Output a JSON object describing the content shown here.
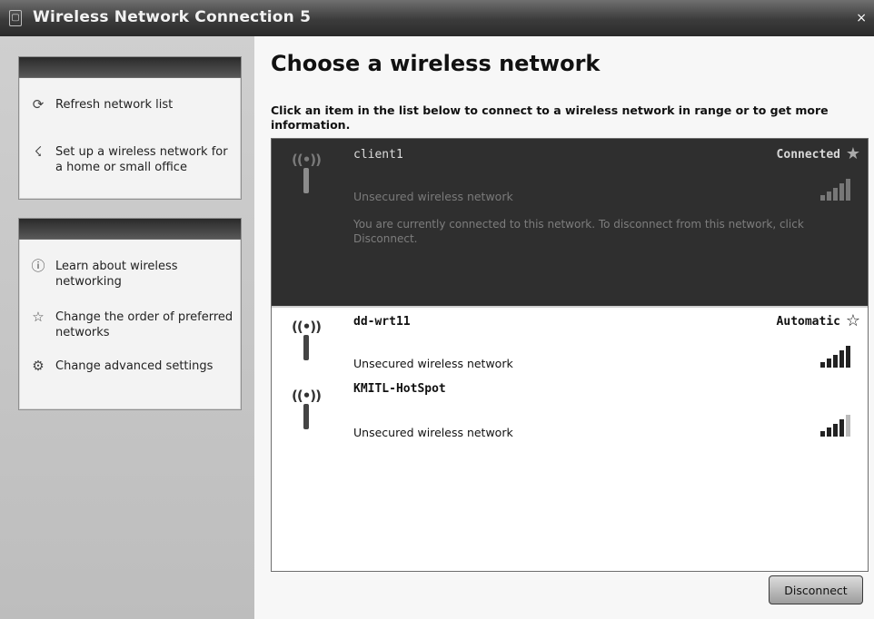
{
  "window": {
    "title": "Wireless Network Connection 5",
    "close_label": "×"
  },
  "sidebar": {
    "network_tasks": [
      {
        "label": "Refresh network list",
        "icon": "refresh-icon"
      },
      {
        "label": "Set up a wireless network for a home or small office",
        "icon": "setup-wizard-icon"
      }
    ],
    "related_tasks": [
      {
        "label": "Learn about wireless networking",
        "icon": "info-icon"
      },
      {
        "label": "Change the order of preferred networks",
        "icon": "star-icon"
      },
      {
        "label": "Change advanced settings",
        "icon": "settings-icon"
      }
    ]
  },
  "main": {
    "heading": "Choose a wireless network",
    "instruction": "Click an item in the list below to connect to a wireless network in range or to get more information."
  },
  "networks": [
    {
      "ssid": "client1",
      "status": "Connected",
      "security": "Unsecured wireless network",
      "note": "You are currently connected to this network. To disconnect from this network, click Disconnect.",
      "signal_bars": 5,
      "selected": true
    },
    {
      "ssid": "dd-wrt11",
      "status": "Automatic",
      "security": "Unsecured wireless network",
      "signal_bars": 5,
      "selected": false
    },
    {
      "ssid": "KMITL-HotSpot",
      "status": "",
      "security": "Unsecured wireless network",
      "signal_bars": 4,
      "selected": false
    }
  ],
  "buttons": {
    "disconnect": "Disconnect"
  }
}
